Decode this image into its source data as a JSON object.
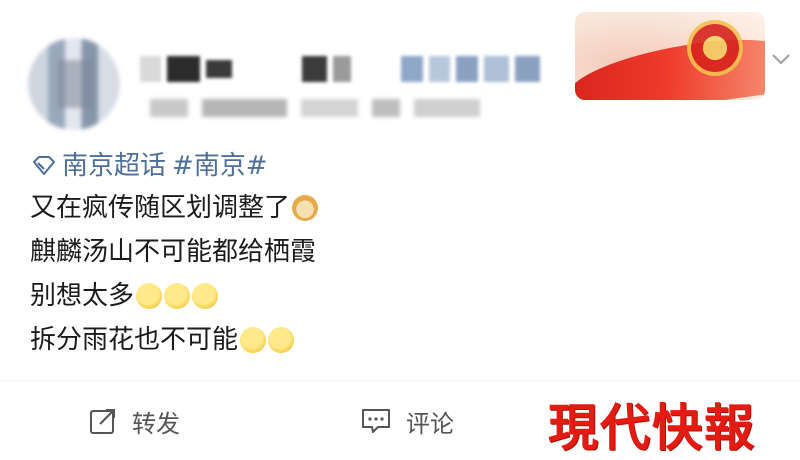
{
  "topics": [
    "南京超话",
    "#南京#"
  ],
  "lines": [
    {
      "text": "又在疯传随区划调整了",
      "emojis": [
        "doge"
      ]
    },
    {
      "text": "麒麟汤山不可能都给栖霞",
      "emojis": []
    },
    {
      "text": "别想太多",
      "emojis": [
        "shh",
        "shh",
        "shh"
      ]
    },
    {
      "text": "拆分雨花也不可能",
      "emojis": [
        "shh",
        "shh"
      ]
    }
  ],
  "actions": {
    "repost_label": "转发",
    "comment_label": "评论"
  },
  "watermark": "現代快報",
  "colors": {
    "topic": "#4d6f99",
    "watermark": "#e31b12"
  }
}
